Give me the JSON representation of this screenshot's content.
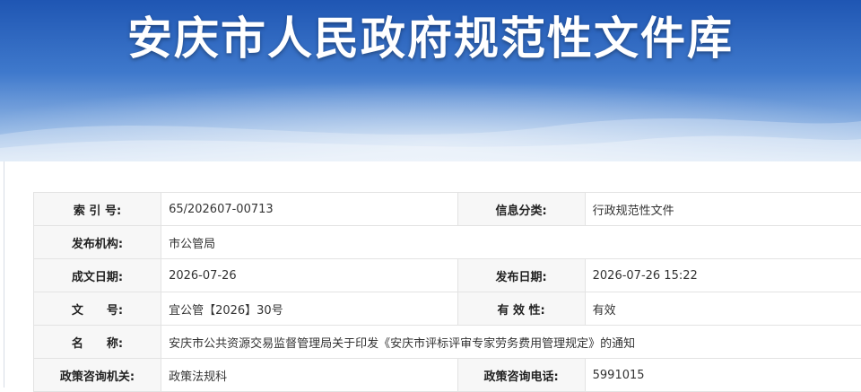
{
  "header": {
    "title": "安庆市人民政府规范性文件库"
  },
  "meta": {
    "index_label": "索 引 号:",
    "index_value": "65/202607-00713",
    "category_label": "信息分类:",
    "category_value": "行政规范性文件",
    "publisher_label": "发布机构:",
    "publisher_value": "市公管局",
    "written_date_label": "成文日期:",
    "written_date_value": "2026-07-26",
    "publish_date_label": "发布日期:",
    "publish_date_value": "2026-07-26 15:22",
    "doc_no_label": "文　　号:",
    "doc_no_value": "宜公管【2026】30号",
    "validity_label": "有 效 性:",
    "validity_value": "有效",
    "name_label": "名　　称:",
    "name_value": "安庆市公共资源交易监督管理局关于印发《安庆市评标评审专家劳务费用管理规定》的通知",
    "consult_org_label": "政策咨询机关:",
    "consult_org_value": "政策法规科",
    "consult_phone_label": "政策咨询电话:",
    "consult_phone_value": "5991015"
  },
  "colors": {
    "banner_top": "#1f56b3",
    "banner_bottom": "#c7dbf2",
    "label_bg": "#f7f7f7",
    "border": "#e3e3e3"
  }
}
